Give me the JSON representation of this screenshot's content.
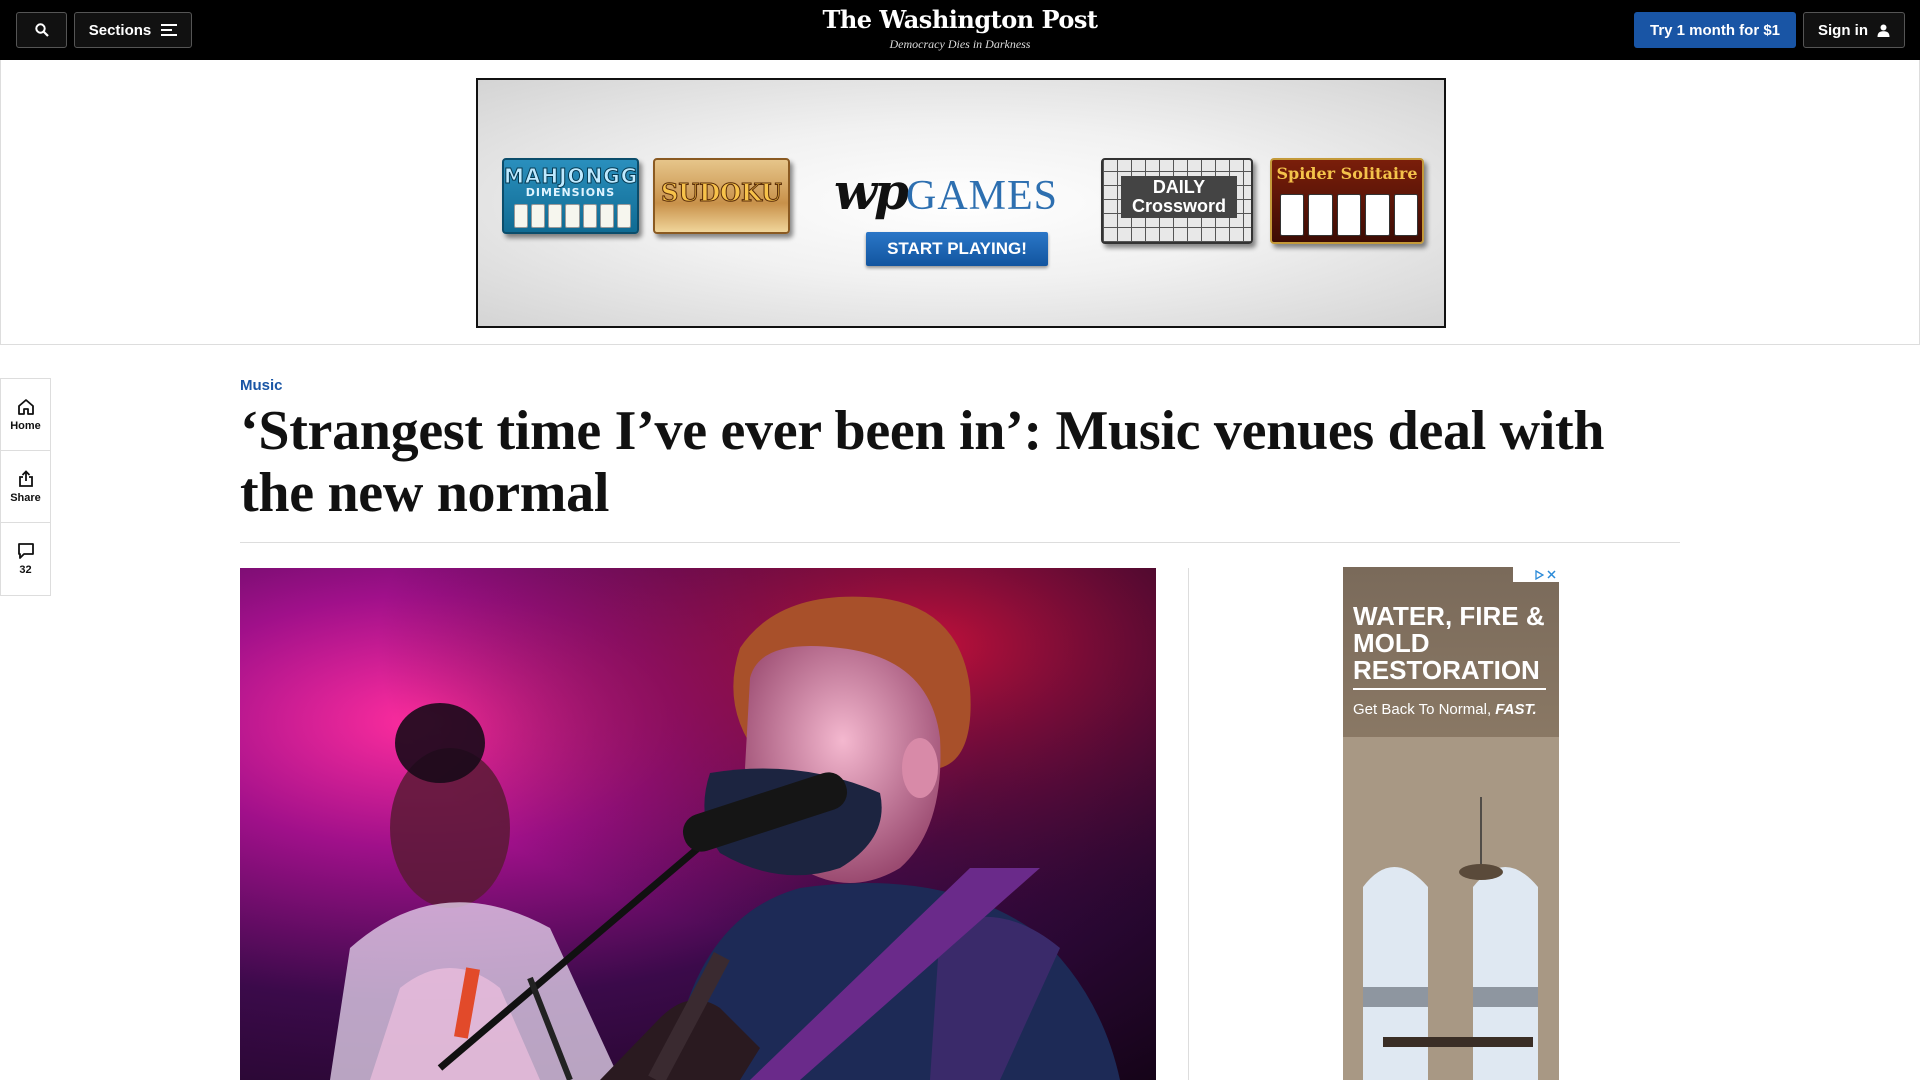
{
  "header": {
    "sections_label": "Sections",
    "logo_text": "The Washington Post",
    "tagline": "Democracy Dies in Darkness",
    "trial_label": "Try 1 month for $1",
    "signin_label": "Sign in"
  },
  "ad_banner": {
    "mahjongg_title": "MAHJONGG",
    "mahjongg_subtitle": "DIMENSIONS",
    "sudoku_title": "SUDOKU",
    "wp_mark": "wp",
    "games_label": "GAMES",
    "cta_label": "START PLAYING!",
    "crossword_line1": "DAILY",
    "crossword_line2": "Crossword",
    "spider_title": "Spider Solitaire"
  },
  "rail": {
    "home_label": "Home",
    "share_label": "Share",
    "comments_count": "32"
  },
  "article": {
    "kicker": "Music",
    "headline": "‘Strangest time I’ve ever been in’: Music venues deal with the new normal"
  },
  "side_ad": {
    "headline": "WATER, FIRE & MOLD RESTORATION",
    "subline_prefix": "Get Back To Normal, ",
    "subline_emphasis": "FAST."
  }
}
